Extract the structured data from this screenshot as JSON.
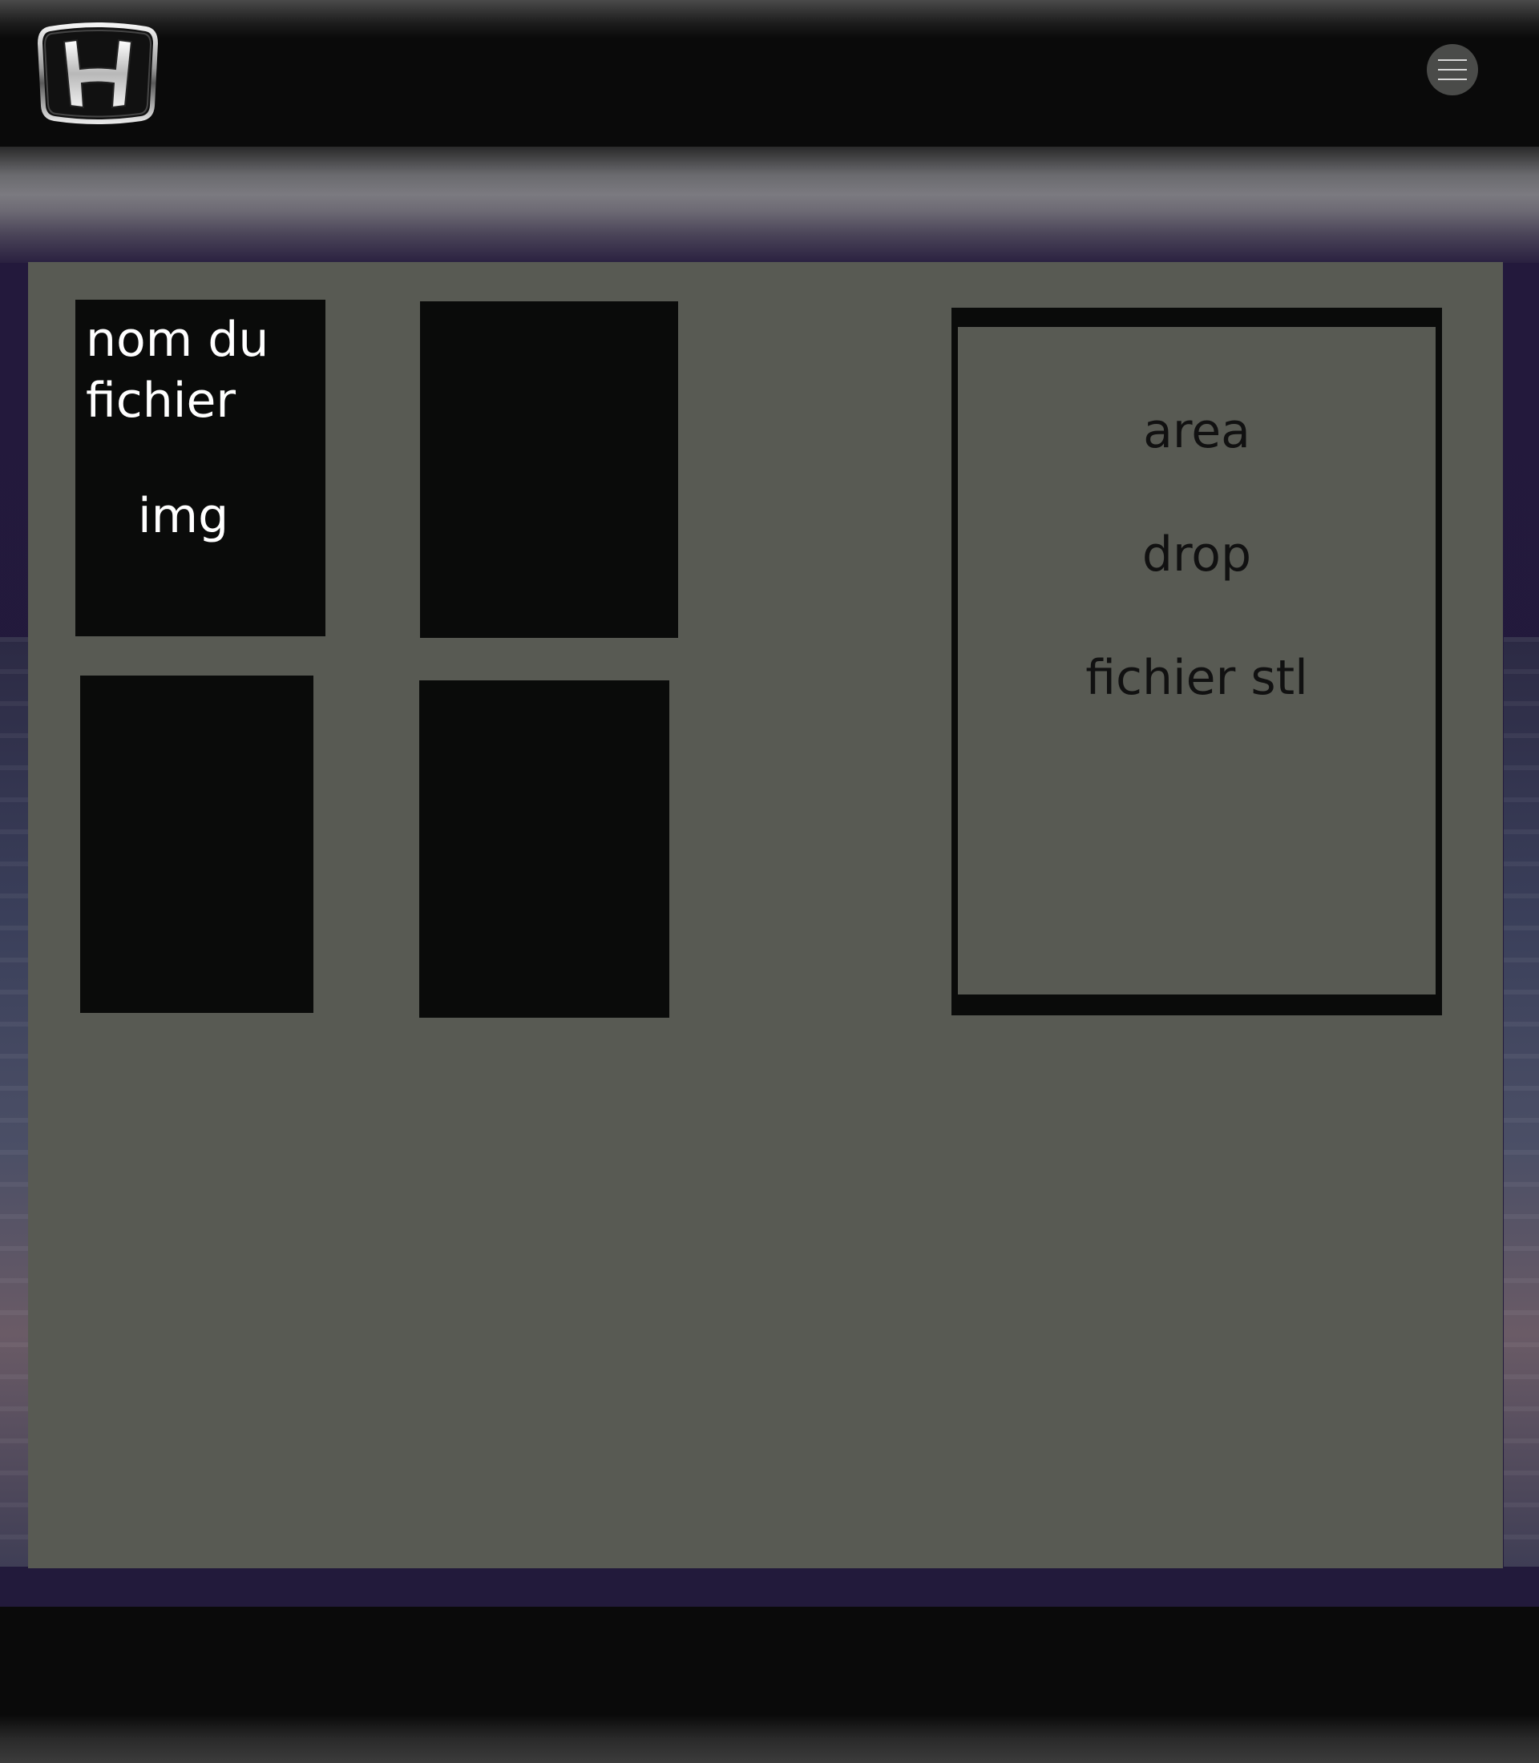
{
  "header": {
    "logo_icon": "honda-logo-icon",
    "menu_icon": "hamburger-menu-icon"
  },
  "cards": [
    {
      "name_label": "nom du fichier",
      "img_label": "img"
    },
    {
      "name_label": "",
      "img_label": ""
    },
    {
      "name_label": "",
      "img_label": ""
    },
    {
      "name_label": "",
      "img_label": ""
    }
  ],
  "drop_area": {
    "line1": "area",
    "line2": "drop",
    "line3": "fichier stl"
  },
  "colors": {
    "panel": "#585a53",
    "card": "#0a0b0a",
    "header": "#0a0a0a",
    "accent_purple": "#23193c"
  }
}
